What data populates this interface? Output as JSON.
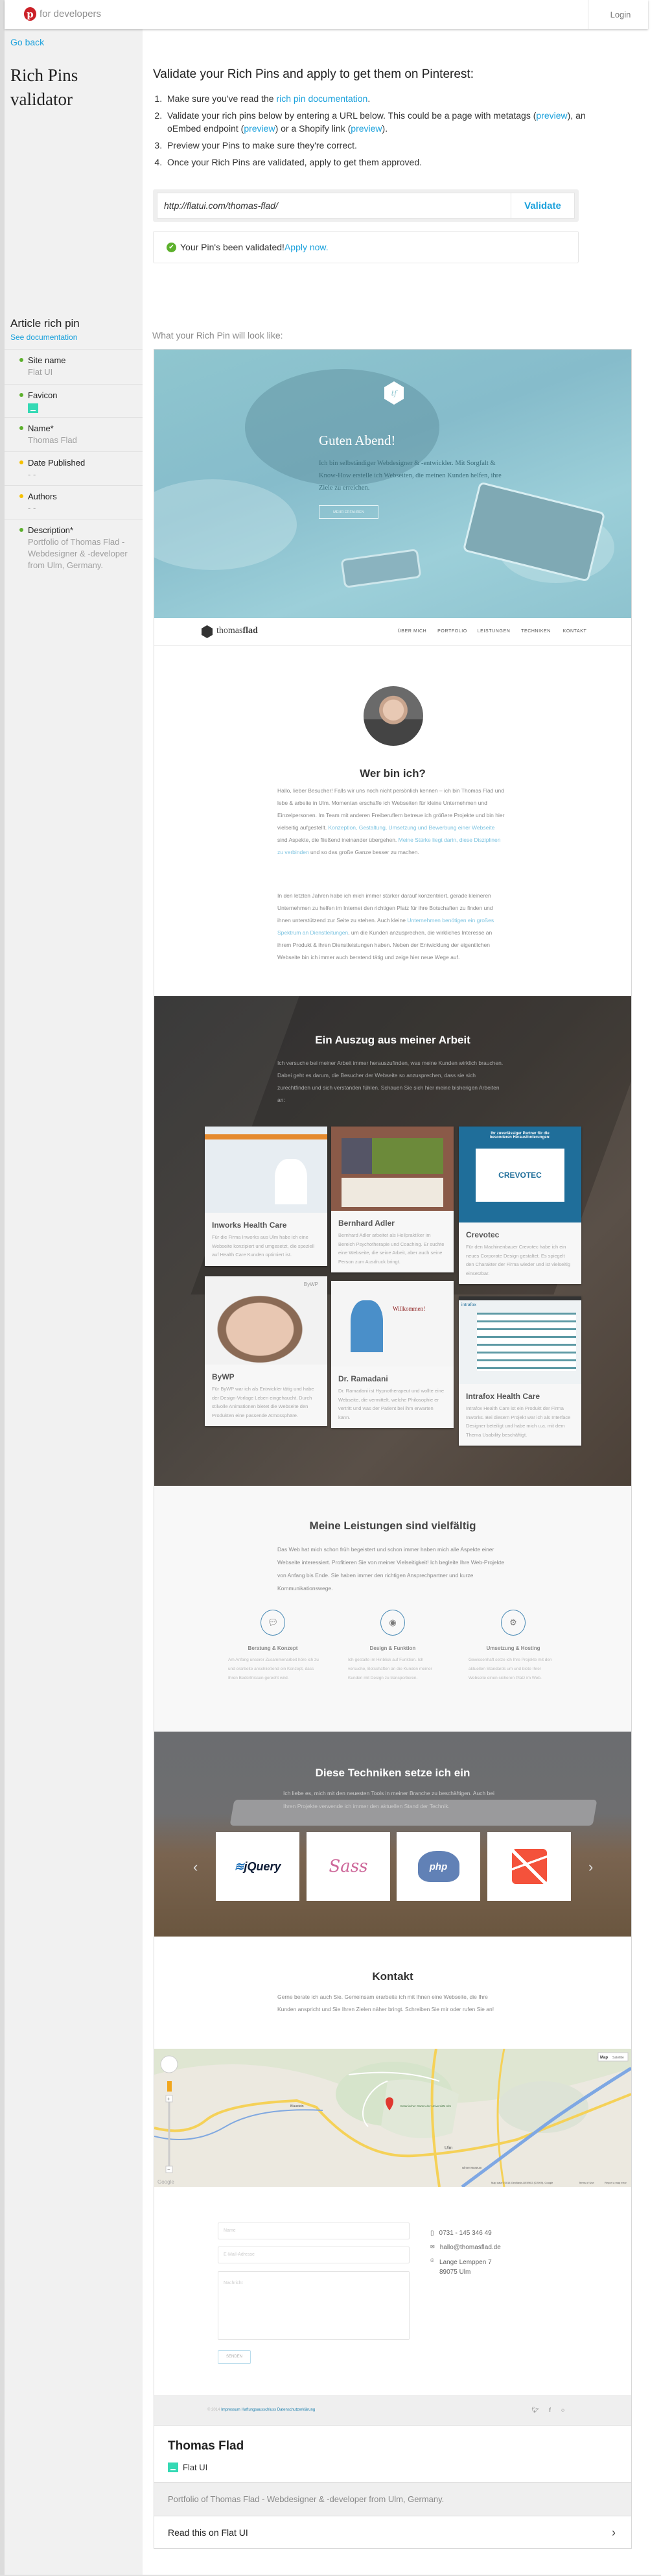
{
  "header": {
    "brand": "for developers",
    "login": "Login"
  },
  "sidebar": {
    "go_back": "Go back",
    "title": "Rich Pins validator",
    "pin_type": "Article rich pin",
    "see_docs": "See documentation",
    "fields": [
      {
        "label": "Site name",
        "value": "Flat UI",
        "status": "green"
      },
      {
        "label": "Favicon",
        "value": "",
        "status": "green"
      },
      {
        "label": "Name*",
        "value": "Thomas Flad",
        "status": "green"
      },
      {
        "label": "Date Published",
        "value": "- -",
        "status": "yellow"
      },
      {
        "label": "Authors",
        "value": "- -",
        "status": "yellow"
      },
      {
        "label": "Description*",
        "value": "Portfolio of Thomas Flad - Webdesigner & -developer from Ulm, Germany.",
        "status": "green"
      }
    ]
  },
  "colors": {
    "green": "#5cb02c",
    "yellow": "#f5c000",
    "link": "#1ba1dc",
    "pinterest": "#cb2027",
    "favicon": "#34d9b4"
  },
  "main": {
    "heading": "Validate your Rich Pins and apply to get them on Pinterest:",
    "steps": {
      "s1a": "Make sure you've read the ",
      "s1link": "rich pin documentation",
      "s1b": ".",
      "s2a": "Validate your rich pins below by entering a URL below. This could be a page with metatags (",
      "preview": "preview",
      "s2b": "), an oEmbed endpoint (",
      "s2c": ") or a Shopify link (",
      "s2d": ").",
      "s3": "Preview your Pins to make sure they're correct.",
      "s4": "Once your Rich Pins are validated, apply to get them approved."
    },
    "url_value": "http://flatui.com/thomas-flad/",
    "validate_label": "Validate",
    "success_text": "Your Pin's been validated! ",
    "apply_link": "Apply now.",
    "preview_label": "What your Rich Pin will look like:"
  },
  "preview": {
    "hero": {
      "logo": "tf",
      "title": "Guten Abend!",
      "text": "Ich bin selbständiger Webdesigner & -entwickler. Mit Sorgfalt & Know-How erstelle ich Webseiten, die meinen Kunden helfen, ihre Ziele zu erreichen.",
      "button": "MEHR ERFAHREN"
    },
    "nav": {
      "brand_light": "thomas",
      "brand_bold": "flad",
      "items": [
        "ÜBER MICH",
        "PORTFOLIO",
        "LEISTUNGEN",
        "TECHNIKEN",
        "KONTAKT"
      ]
    },
    "about": {
      "title": "Wer bin ich?",
      "p1a": "Hallo, lieber Besucher! Falls wir uns noch nicht persönlich kennen – ich bin Thomas Flad und lebe & arbeite in Ulm. Momentan erschaffe ich Webseiten für kleine Unternehmen und Einzelpersonen. Im Team mit anderen Freiberuflern betreue ich größere Projekte und bin hier vielseitig aufgestellt. ",
      "p1l1": "Konzeption, Gestaltung, Umsetzung und Bewerbung einer Webseite",
      "p1b": " sind Aspekte, die fließend ineinander übergehen. ",
      "p1l2": "Meine Stärke liegt darin, diese Disziplinen zu verbinden",
      "p1c": " und so das große Ganze besser zu machen.",
      "p2a": "In den letzten Jahren habe ich mich immer stärker darauf konzentriert, gerade kleineren Unternehmen zu helfen im Internet den richtigen Platz für ihre Botschaften zu finden und ihnen unterstützend zur Seite zu stehen. Auch kleine ",
      "p2l": "Unternehmen benötigen ein großes Spektrum an Dienstleitungen",
      "p2b": ", um die Kunden anzusprechen, die wirkliches Interesse an ihrem Produkt & ihren Dienstleistungen haben. Neben der Entwicklung der eigentlichen Webseite bin ich immer auch beratend tätig und zeige hier neue Wege auf."
    },
    "portfolio": {
      "title": "Ein Auszug aus meiner Arbeit",
      "text": "Ich versuche bei meiner Arbeit immer herauszufinden, was meine Kunden wirklich brauchen. Dabei geht es darum, die Besucher der Webseite so anzusprechen, dass sie sich zurechtfinden und sich verstanden fühlen. Schauen Sie sich hier meine bisherigen Arbeiten an:",
      "cards": [
        {
          "title": "Inworks Health Care",
          "text": "Für die Firma Inworks aus Ulm habe ich eine Webseite konzipiert und umgesetzt, die speziell auf Health Care Kunden optimiert ist."
        },
        {
          "title": "Bernhard Adler",
          "text": "Bernhard Adler arbeitet als Heilpraktiker im Bereich Psychotherapie und Coaching. Er suchte eine Webseite, die seine Arbeit, aber auch seine Person zum Ausdruck bringt."
        },
        {
          "title": "Crevotec",
          "text": "Für den Machinenbauer Crevotec habe ich ein neues Corporate Design gestaltet. Es spiegelt den Charakter der Firma wieder und ist vielseitig einsetzbar.",
          "thumb_heading": "Ihr zuverlässiger Partner für die besonderen Herausforderungen:",
          "thumb_logo": "CREVOTEC"
        },
        {
          "title": "ByWP",
          "text": "Für ByWP war ich als Entwickler tätig und habe der Design-Vorlage Leben eingehaucht. Durch stilvolle Animationen bietet die Webseite den Produkten eine passende Atmossphäre.",
          "thumb_logo": "ByWP"
        },
        {
          "title": "Dr. Ramadani",
          "text": "Dr. Ramadani ist Hypnotherapeut und wollte eine Webseite, die vermittelt, welche Philosophie er vertritt und was der Patient bei ihm erwarten kann.",
          "thumb_heading": "Willkommen!"
        },
        {
          "title": "Intrafox Health Care",
          "text": "Intrafox Health Care ist ein Produkt der Firma Inworks. Bei diesem Projekt war ich als Interface Designer beteiligt und habe mich u.a. mit dem Thema Usability beschäftigt.",
          "thumb_logo": "intrafox"
        }
      ]
    },
    "services": {
      "title": "Meine Leistungen sind vielfältig",
      "text": "Das Web hat mich schon früh begeistert und schon immer haben mich alle Aspekte einer Webseite interessiert. Profitieren Sie von meiner Vielseitigkeit! Ich begleite Ihre Web-Projekte von Anfang bis Ende. Sie haben immer den richtigen Ansprechpartner und kurze Kommunikationswege.",
      "items": [
        {
          "icon": "speech-bubble-icon",
          "title": "Beratung & Konzept",
          "text": "Am Anfang unserer Zusammenarbeit höre ich zu und erarbeite anschließend ein Konzept, dass Ihren Bedürfnissen gerecht wird."
        },
        {
          "icon": "eye-icon",
          "title": "Design & Funktion",
          "text": "Ich gestalte im Hinblick auf Funktion. Ich versuche, Botschaften an die Kunden meiner Kunden mit Design zu transportieren."
        },
        {
          "icon": "gear-icon",
          "title": "Umsetzung & Hosting",
          "text": "Gewissenhaft setze ich Ihre Projekte mit den aktuellen Standards um und biete Ihrer Webseite einen sicheren Platz im Web."
        }
      ]
    },
    "tech": {
      "title": "Diese Techniken setze ich ein",
      "text": "Ich liebe es, mich mit den neuesten Tools in meiner Branche zu beschäftigen. Auch bei Ihren Projekte verwende ich immer den aktuellen Stand der Technik.",
      "logos": [
        "jQuery",
        "Sass",
        "php",
        "laravel"
      ]
    },
    "contact": {
      "title": "Kontakt",
      "text": "Gerne berate ich auch Sie. Gemeinsam erarbeite ich mit Ihnen eine Webseite, die Ihre Kunden anspricht und Sie Ihren Zielen näher bringt. Schreiben Sie mir oder rufen Sie an!",
      "map": {
        "type_map": "Map",
        "type_satellite": "Satellite",
        "city": "Ulm",
        "town": "Blaustein",
        "poi": "Botanischer Garten der Universität Ulm",
        "museum": "Ulmer Museum",
        "attribution": "Map data ©2014 GeoBasis-DE/BKG (©2009), Google",
        "terms": "Terms of Use",
        "report": "Report a map error",
        "google": "Google"
      },
      "name_placeholder": "Name",
      "email_placeholder": "E-Mail-Adresse",
      "message_placeholder": "Nachricht",
      "send": "SENDEN",
      "phone": "0731 - 145 346 49",
      "email": "hallo@thomasflad.de",
      "street": "Lange Lemppen 7",
      "city_line": "89075 Ulm"
    },
    "footer": {
      "copyright": "© 2014",
      "links": [
        "Impressum",
        "Haftungsausschluss",
        "Datenschutzerklärung"
      ]
    }
  },
  "pin": {
    "title": "Thomas Flad",
    "site": "Flat UI",
    "description": "Portfolio of Thomas Flad - Webdesigner & -developer from Ulm, Germany.",
    "read": "Read this on Flat UI"
  }
}
